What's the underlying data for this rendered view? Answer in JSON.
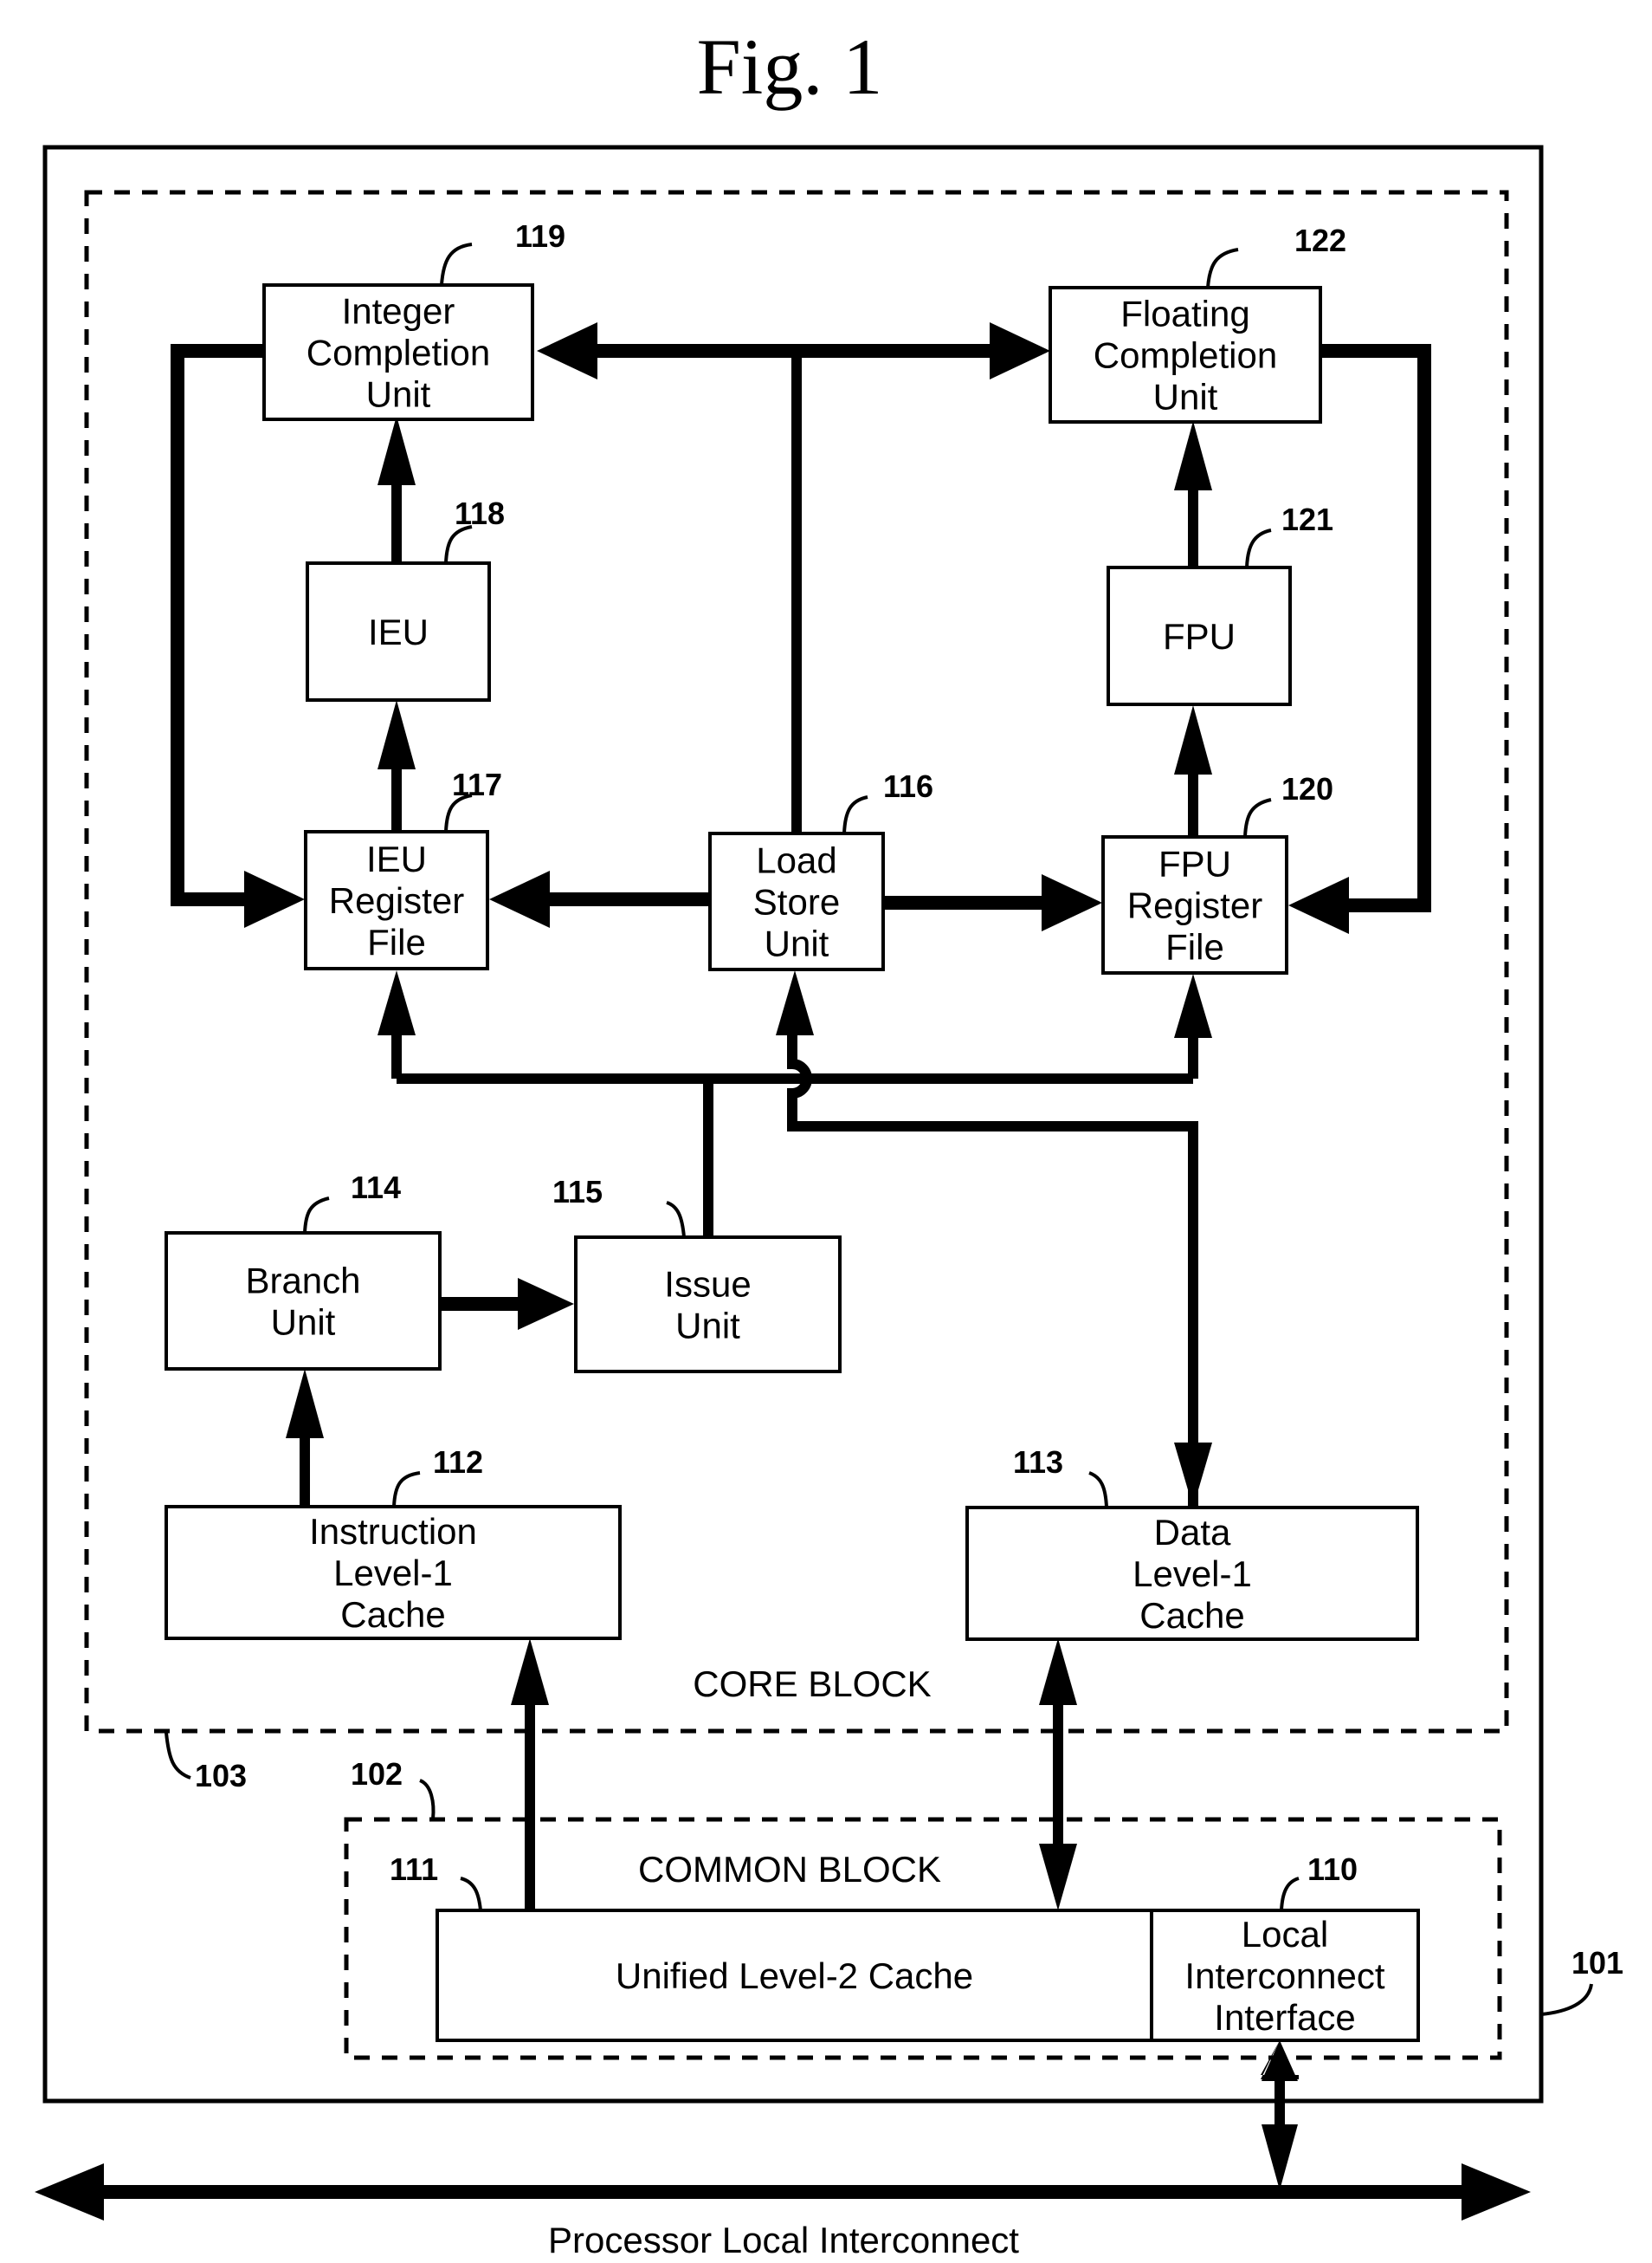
{
  "figure": {
    "title": "Fig. 1"
  },
  "regions": {
    "processor": {
      "ref": "101"
    },
    "common_block": {
      "label": "COMMON BLOCK",
      "ref": "102"
    },
    "core_block": {
      "label": "CORE BLOCK",
      "ref": "103"
    }
  },
  "units": {
    "integer_completion": {
      "ref": "119",
      "lines": [
        "Integer",
        "Completion",
        "Unit"
      ]
    },
    "floating_completion": {
      "ref": "122",
      "lines": [
        "Floating",
        "Completion",
        "Unit"
      ]
    },
    "ieu": {
      "ref": "118",
      "lines": [
        "IEU"
      ]
    },
    "fpu": {
      "ref": "121",
      "lines": [
        "FPU"
      ]
    },
    "ieu_register_file": {
      "ref": "117",
      "lines": [
        "IEU",
        "Register",
        "File"
      ]
    },
    "load_store_unit": {
      "ref": "116",
      "lines": [
        "Load",
        "Store",
        "Unit"
      ]
    },
    "fpu_register_file": {
      "ref": "120",
      "lines": [
        "FPU",
        "Register",
        "File"
      ]
    },
    "branch_unit": {
      "ref": "114",
      "lines": [
        "Branch",
        "Unit"
      ]
    },
    "issue_unit": {
      "ref": "115",
      "lines": [
        "Issue",
        "Unit"
      ]
    },
    "instruction_l1_cache": {
      "ref": "112",
      "lines": [
        "Instruction",
        "Level-1",
        "Cache"
      ]
    },
    "data_l1_cache": {
      "ref": "113",
      "lines": [
        "Data",
        "Level-1",
        "Cache"
      ]
    },
    "unified_l2_cache": {
      "ref": "111",
      "lines": [
        "Unified Level-2 Cache"
      ]
    },
    "local_interconnect_interface": {
      "ref": "110",
      "lines": [
        "Local",
        "Interconnect",
        "Interface"
      ]
    }
  },
  "bus": {
    "label": "Processor Local Interconnect"
  }
}
